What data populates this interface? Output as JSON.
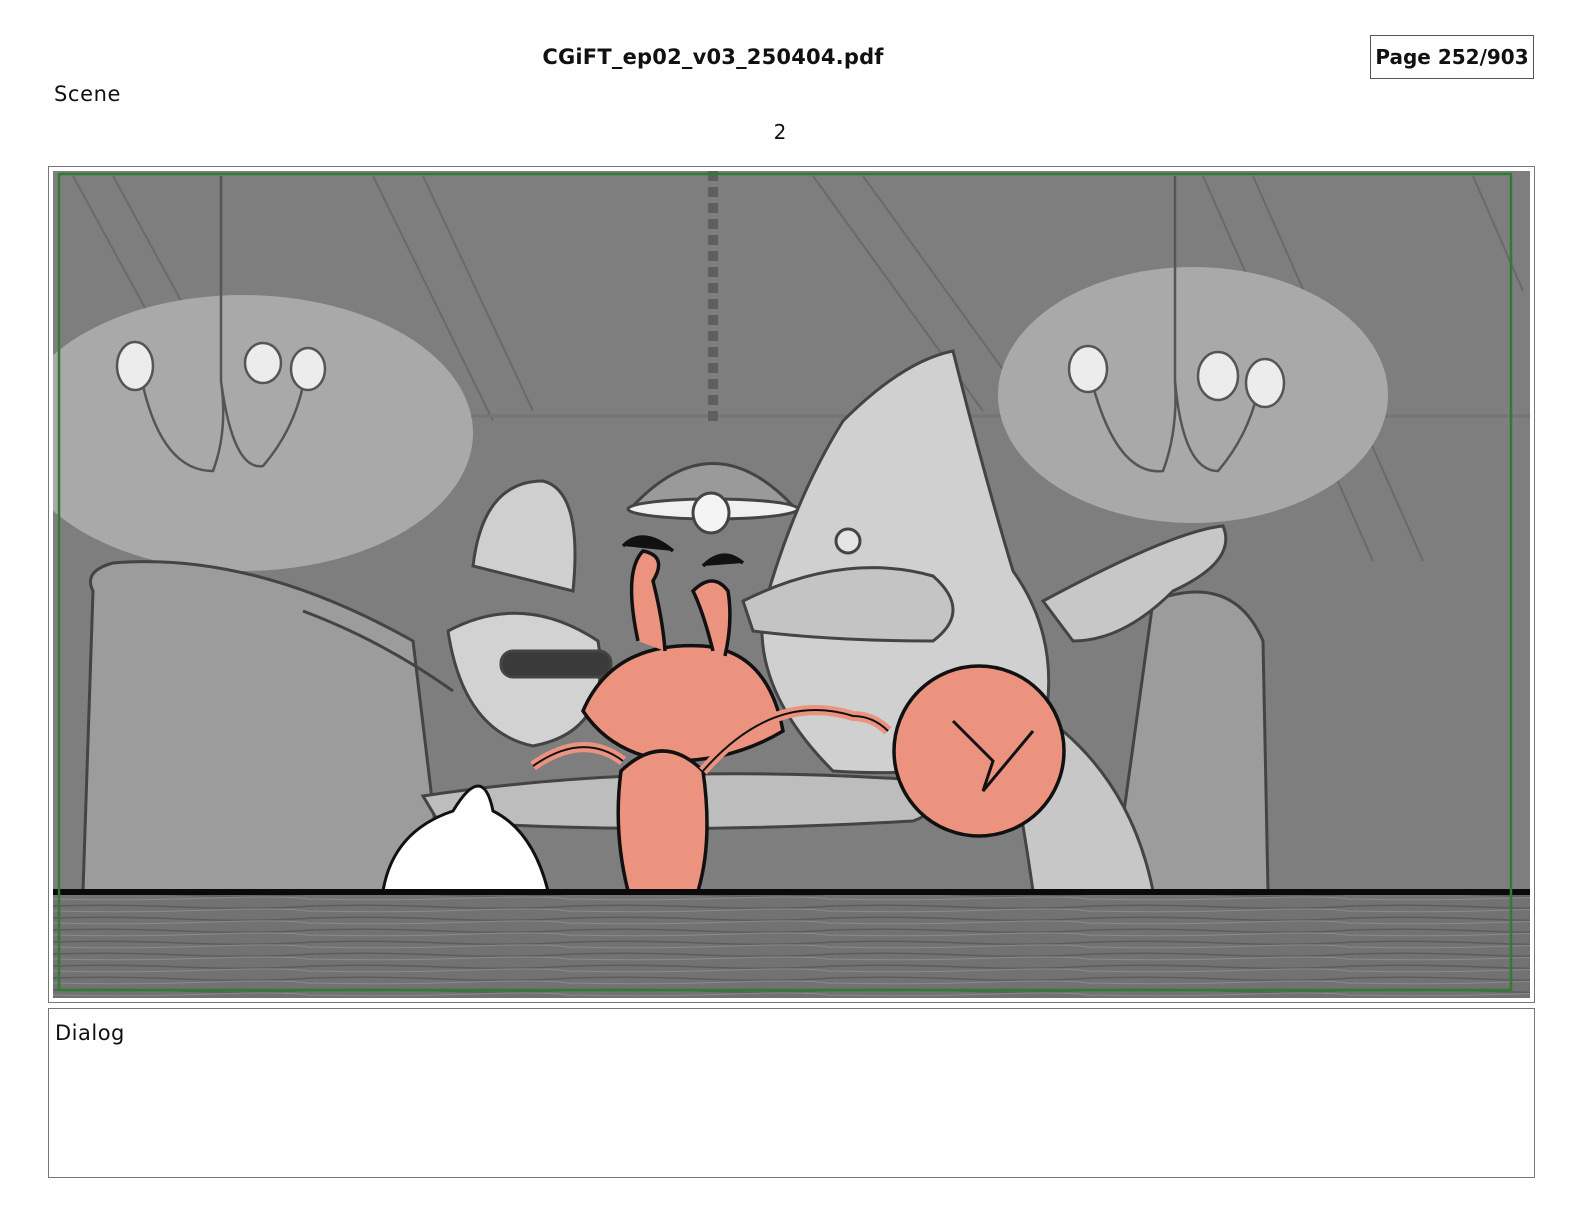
{
  "header": {
    "file_title": "CGiFT_ep02_v03_250404.pdf",
    "page_indicator": "Page 252/903"
  },
  "scene": {
    "label": "Scene",
    "number": "2"
  },
  "dialog": {
    "label": "Dialog"
  },
  "colors": {
    "safe_frame": "#2e7d32",
    "crab": "#ec9380",
    "background_gray": "#7e7e7e"
  }
}
